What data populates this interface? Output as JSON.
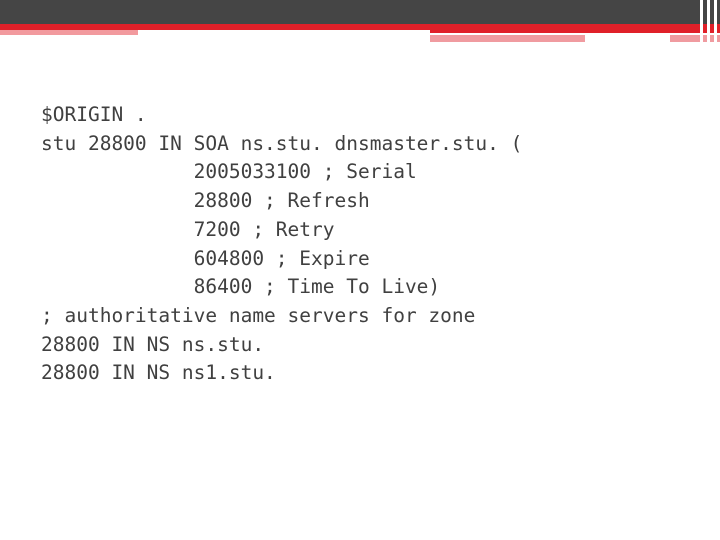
{
  "slide": {
    "background_color": "#ffffff",
    "banner": {
      "dark_color": "#454545",
      "red_color": "#e02029",
      "pink_color": "#f09ba0",
      "stripe_color": "#ffffff"
    },
    "text_color": "#404040"
  },
  "zone_file": {
    "lines": [
      "$ORIGIN .",
      "stu 28800 IN SOA ns.stu. dnsmaster.stu. (",
      "             2005033100 ; Serial",
      "             28800 ; Refresh",
      "             7200 ; Retry",
      "             604800 ; Expire",
      "             86400 ; Time To Live)",
      "; authoritative name servers for zone",
      "28800 IN NS ns.stu.",
      "28800 IN NS ns1.stu."
    ],
    "records": {
      "origin": ".",
      "zone": "stu",
      "ttl": "28800",
      "class": "IN",
      "soa": {
        "type": "SOA",
        "primary_ns": "ns.stu.",
        "responsible_mailbox": "dnsmaster.stu.",
        "serial": "2005033100",
        "serial_label": "Serial",
        "refresh": "28800",
        "refresh_label": "Refresh",
        "retry": "7200",
        "retry_label": "Retry",
        "expire": "604800",
        "expire_label": "Expire",
        "minimum_ttl": "86400",
        "minimum_ttl_label": "Time To Live"
      },
      "comment": "; authoritative name servers for zone",
      "nameservers": [
        {
          "ttl": "28800",
          "class": "IN",
          "type": "NS",
          "target": "ns.stu."
        },
        {
          "ttl": "28800",
          "class": "IN",
          "type": "NS",
          "target": "ns1.stu."
        }
      ]
    }
  }
}
